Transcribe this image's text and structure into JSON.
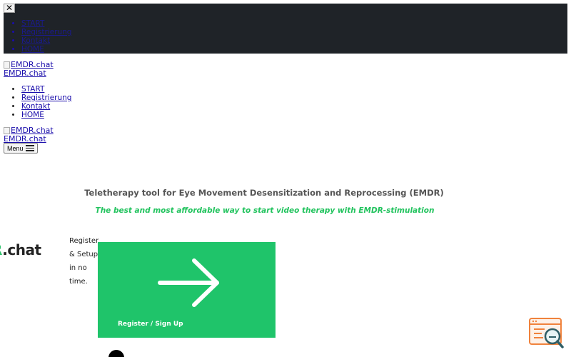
{
  "mobile_nav": {
    "close_symbol": "✕",
    "items": [
      {
        "label": "START"
      },
      {
        "label": "Registrierung"
      },
      {
        "label": "Kontakt"
      },
      {
        "label": "HOME"
      }
    ]
  },
  "logo_1": {
    "img_alt": "EMDR.chat",
    "site_title": "EMDR.chat"
  },
  "main_nav": {
    "items": [
      {
        "label": "START"
      },
      {
        "label": "Registrierung"
      },
      {
        "label": "Kontakt"
      },
      {
        "label": "HOME"
      }
    ]
  },
  "logo_2": {
    "img_alt": "EMDR.chat",
    "site_title": "EMDR.chat"
  },
  "menu_button": {
    "label": "Menu",
    "icon": "hamburger-icon"
  },
  "hero": {
    "headline": "Teletherapy tool for Eye Movement Desensitization and Reprocessing (EMDR)",
    "subline": "The best and most affordable way to start video therapy with EMDR-stimulation"
  },
  "brand_logo": {
    "prefix": "R",
    "suffix": ".chat"
  },
  "register_text": [
    "Register",
    "& Setup",
    "in no",
    "time."
  ],
  "register_card": {
    "label": "Register / Sign Up",
    "icon": "arrow-right-icon"
  },
  "help_widget": {
    "icon": "search-browser-icon"
  },
  "colors": {
    "nav_bg": "#1f2328",
    "accent_green": "#1fc46a",
    "subline_green": "#22c35e",
    "help_orange": "#f0823c"
  }
}
